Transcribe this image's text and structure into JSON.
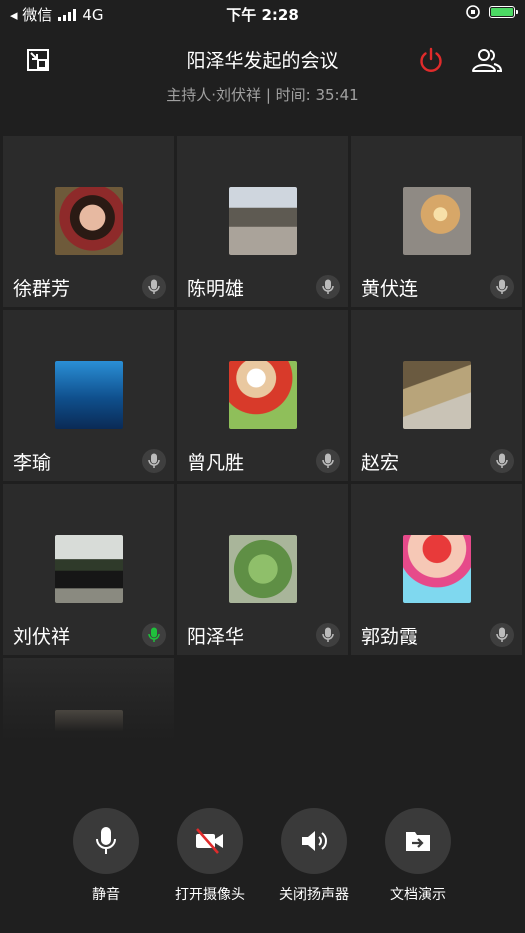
{
  "status_bar": {
    "carrier": "◂ 微信",
    "network": "4G",
    "time": "下午 2:28"
  },
  "header": {
    "title": "阳泽华发起的会议",
    "subtitle": "主持人·刘伏祥 | 时间: 35:41"
  },
  "participants": [
    {
      "name": "徐群芳",
      "mic": "muted"
    },
    {
      "name": "陈明雄",
      "mic": "muted"
    },
    {
      "name": "黄伏连",
      "mic": "muted"
    },
    {
      "name": "李瑜",
      "mic": "muted"
    },
    {
      "name": "曾凡胜",
      "mic": "muted"
    },
    {
      "name": "赵宏",
      "mic": "muted"
    },
    {
      "name": "刘伏祥",
      "mic": "speaking"
    },
    {
      "name": "阳泽华",
      "mic": "muted"
    },
    {
      "name": "郭劲霞",
      "mic": "muted"
    }
  ],
  "toolbar": {
    "mute_label": "静音",
    "camera_label": "打开摄像头",
    "speaker_label": "关闭扬声器",
    "doc_label": "文档演示"
  },
  "colors": {
    "background": "#1f1f1f",
    "tile": "#2b2b2b",
    "leave_red": "#e02b2b",
    "speaking_green": "#1fc13c"
  }
}
